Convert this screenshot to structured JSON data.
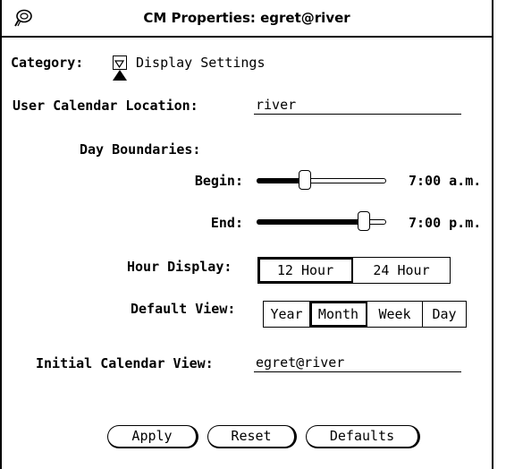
{
  "window": {
    "title": "CM Properties: egret@river"
  },
  "category": {
    "label": "Category:",
    "value": "Display Settings"
  },
  "user_calendar_location": {
    "label": "User Calendar Location:",
    "value": "river"
  },
  "day_boundaries": {
    "label": "Day Boundaries:",
    "begin": {
      "label": "Begin:",
      "time": "7:00 a.m.",
      "fraction": 0.37
    },
    "end": {
      "label": "End:",
      "time": "7:00 p.m.",
      "fraction": 0.83
    }
  },
  "hour_display": {
    "label": "Hour Display:",
    "options": [
      "12 Hour",
      "24 Hour"
    ],
    "selected": "12 Hour"
  },
  "default_view": {
    "label": "Default View:",
    "options": [
      "Year",
      "Month",
      "Week",
      "Day"
    ],
    "selected": "Month"
  },
  "initial_calendar_view": {
    "label": "Initial Calendar View:",
    "value": "egret@river"
  },
  "buttons": {
    "apply": "Apply",
    "reset": "Reset",
    "defaults": "Defaults"
  }
}
